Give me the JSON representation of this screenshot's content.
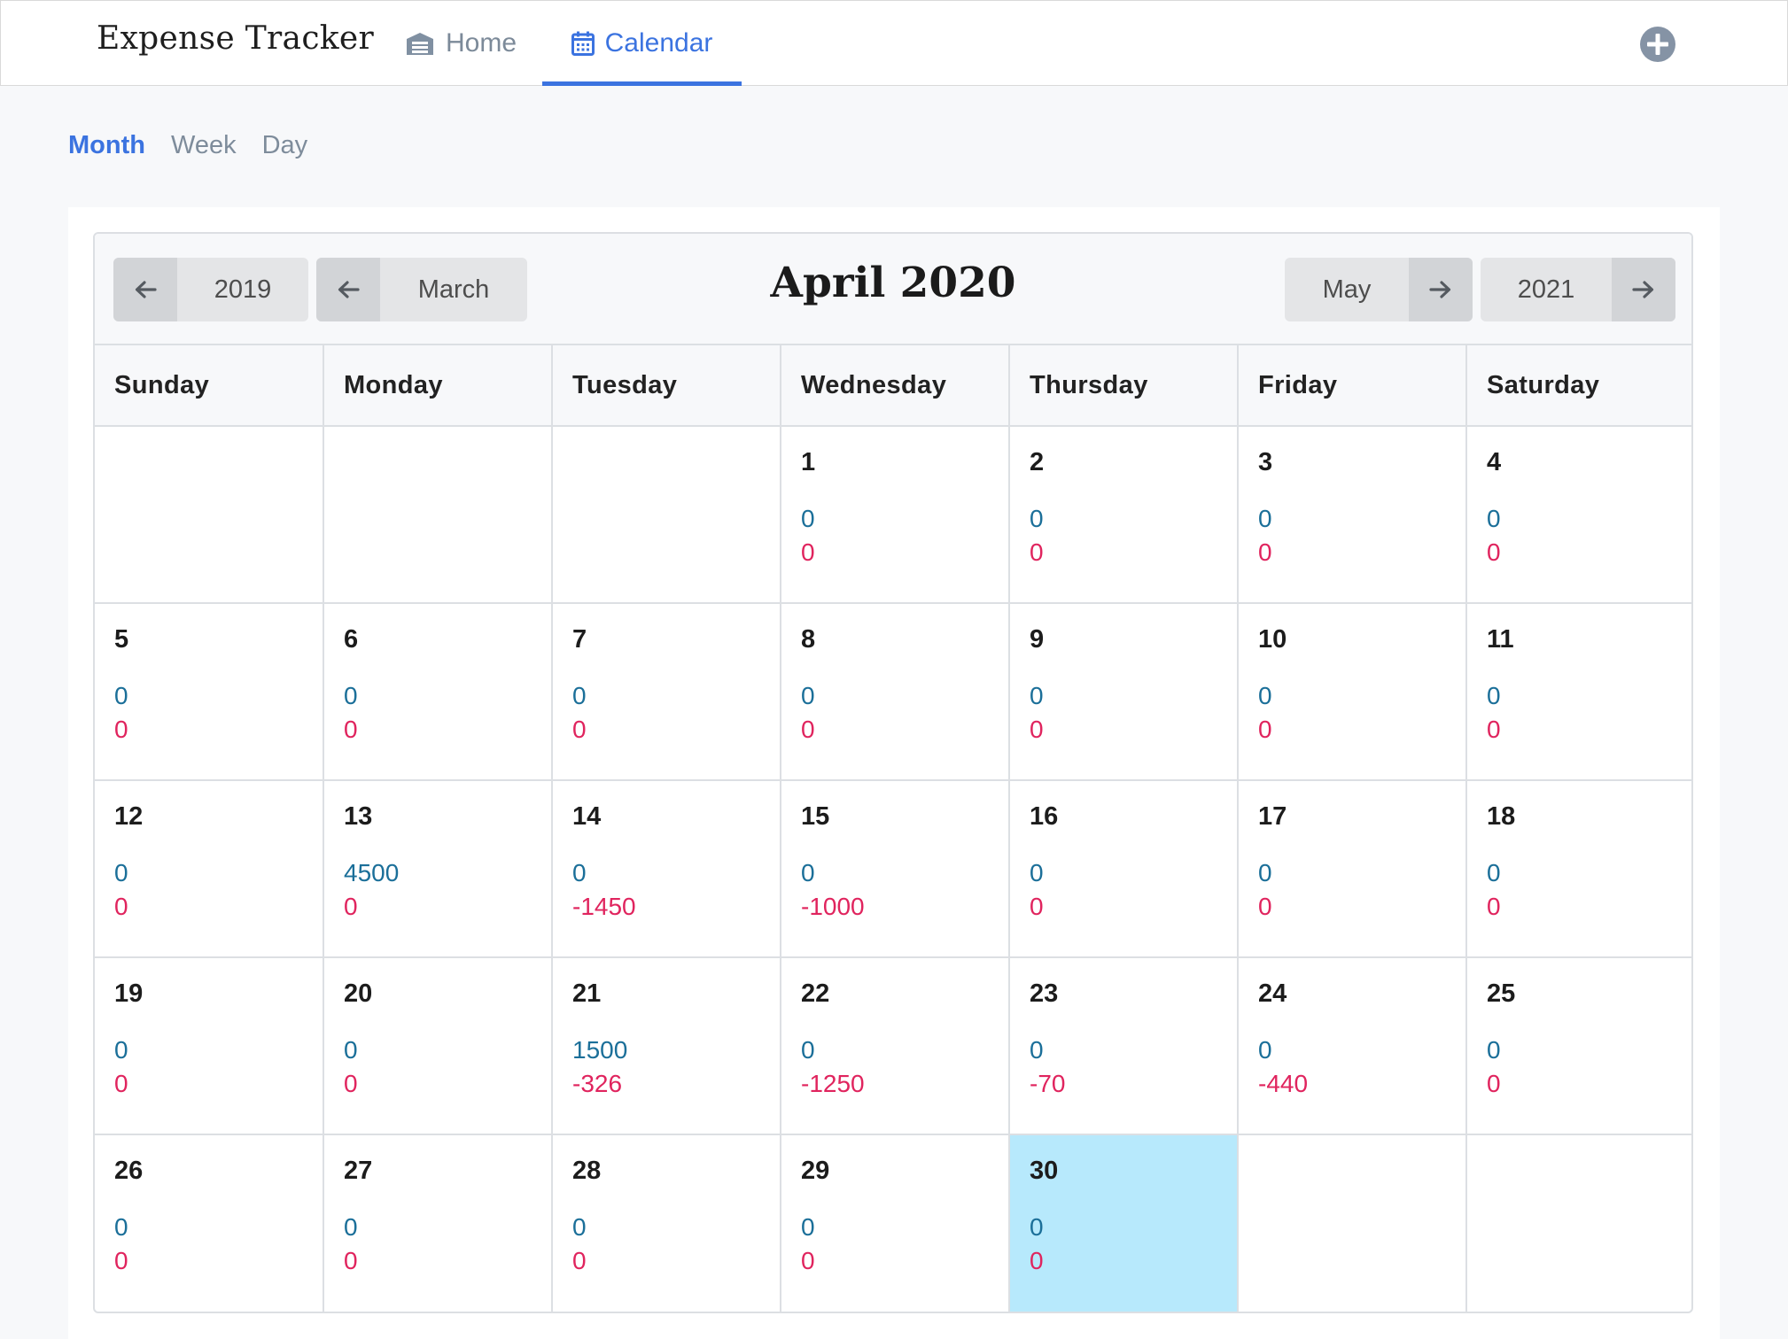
{
  "navbar": {
    "brand": "Expense Tracker",
    "home_label": "Home",
    "calendar_label": "Calendar",
    "active": "Calendar",
    "add_icon": "plus-circle-icon"
  },
  "view_switch": {
    "month": "Month",
    "week": "Week",
    "day": "Day",
    "active": "Month"
  },
  "calendar": {
    "title": "April 2020",
    "prev_year": "2019",
    "prev_month": "March",
    "next_month": "May",
    "next_year": "2021",
    "weekdays": [
      "Sunday",
      "Monday",
      "Tuesday",
      "Wednesday",
      "Thursday",
      "Friday",
      "Saturday"
    ],
    "today": "30",
    "colors": {
      "accent": "#3b73e0",
      "income": "#1b6f99",
      "expense": "#e0245e",
      "today_bg": "#b7e9fc"
    },
    "weeks": [
      [
        null,
        null,
        null,
        {
          "day": "1",
          "income": "0",
          "expense": "0"
        },
        {
          "day": "2",
          "income": "0",
          "expense": "0"
        },
        {
          "day": "3",
          "income": "0",
          "expense": "0"
        },
        {
          "day": "4",
          "income": "0",
          "expense": "0"
        }
      ],
      [
        {
          "day": "5",
          "income": "0",
          "expense": "0"
        },
        {
          "day": "6",
          "income": "0",
          "expense": "0"
        },
        {
          "day": "7",
          "income": "0",
          "expense": "0"
        },
        {
          "day": "8",
          "income": "0",
          "expense": "0"
        },
        {
          "day": "9",
          "income": "0",
          "expense": "0"
        },
        {
          "day": "10",
          "income": "0",
          "expense": "0"
        },
        {
          "day": "11",
          "income": "0",
          "expense": "0"
        }
      ],
      [
        {
          "day": "12",
          "income": "0",
          "expense": "0"
        },
        {
          "day": "13",
          "income": "4500",
          "expense": "0"
        },
        {
          "day": "14",
          "income": "0",
          "expense": "-1450"
        },
        {
          "day": "15",
          "income": "0",
          "expense": "-1000"
        },
        {
          "day": "16",
          "income": "0",
          "expense": "0"
        },
        {
          "day": "17",
          "income": "0",
          "expense": "0"
        },
        {
          "day": "18",
          "income": "0",
          "expense": "0"
        }
      ],
      [
        {
          "day": "19",
          "income": "0",
          "expense": "0"
        },
        {
          "day": "20",
          "income": "0",
          "expense": "0"
        },
        {
          "day": "21",
          "income": "1500",
          "expense": "-326"
        },
        {
          "day": "22",
          "income": "0",
          "expense": "-1250"
        },
        {
          "day": "23",
          "income": "0",
          "expense": "-70"
        },
        {
          "day": "24",
          "income": "0",
          "expense": "-440"
        },
        {
          "day": "25",
          "income": "0",
          "expense": "0"
        }
      ],
      [
        {
          "day": "26",
          "income": "0",
          "expense": "0"
        },
        {
          "day": "27",
          "income": "0",
          "expense": "0"
        },
        {
          "day": "28",
          "income": "0",
          "expense": "0"
        },
        {
          "day": "29",
          "income": "0",
          "expense": "0"
        },
        {
          "day": "30",
          "income": "0",
          "expense": "0"
        },
        null,
        null
      ]
    ]
  }
}
